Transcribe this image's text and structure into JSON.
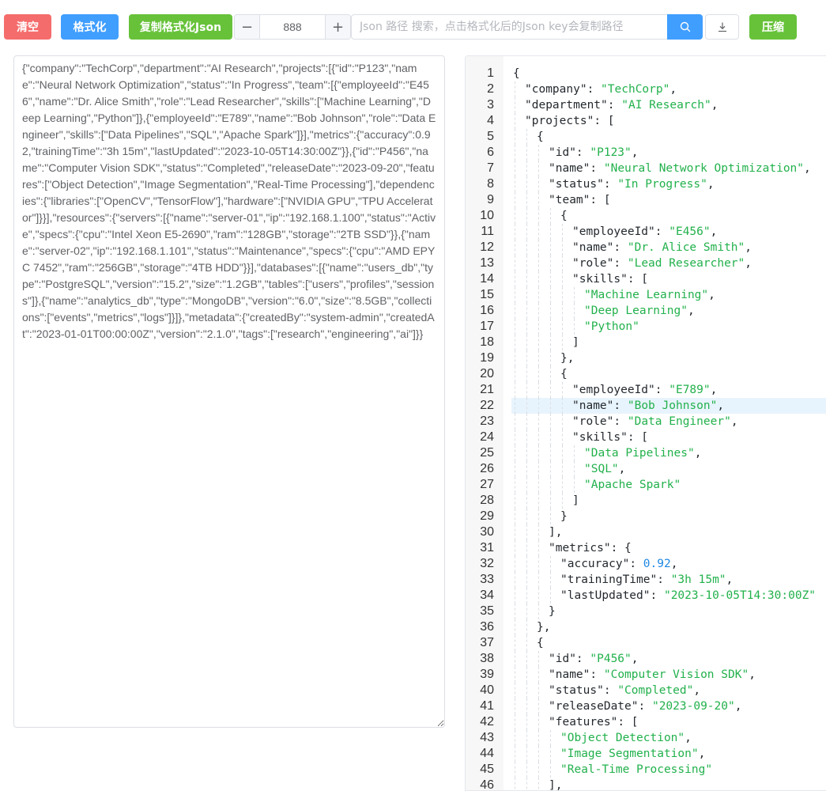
{
  "toolbar": {
    "clear_label": "清空",
    "format_label": "格式化",
    "copy_label": "复制格式化Json",
    "indent_value": "888",
    "minus": "−",
    "plus": "+",
    "search_placeholder": "Json 路径 搜索，点击格式化后的Json key会复制路径",
    "compress_label": "压缩"
  },
  "raw_json": "{\"company\":\"TechCorp\",\"department\":\"AI Research\",\"projects\":[{\"id\":\"P123\",\"name\":\"Neural Network Optimization\",\"status\":\"In Progress\",\"team\":[{\"employeeId\":\"E456\",\"name\":\"Dr. Alice Smith\",\"role\":\"Lead Researcher\",\"skills\":[\"Machine Learning\",\"Deep Learning\",\"Python\"]},{\"employeeId\":\"E789\",\"name\":\"Bob Johnson\",\"role\":\"Data Engineer\",\"skills\":[\"Data Pipelines\",\"SQL\",\"Apache Spark\"]}],\"metrics\":{\"accuracy\":0.92,\"trainingTime\":\"3h 15m\",\"lastUpdated\":\"2023-10-05T14:30:00Z\"}},{\"id\":\"P456\",\"name\":\"Computer Vision SDK\",\"status\":\"Completed\",\"releaseDate\":\"2023-09-20\",\"features\":[\"Object Detection\",\"Image Segmentation\",\"Real-Time Processing\"],\"dependencies\":{\"libraries\":[\"OpenCV\",\"TensorFlow\"],\"hardware\":[\"NVIDIA GPU\",\"TPU Accelerator\"]}}],\"resources\":{\"servers\":[{\"name\":\"server-01\",\"ip\":\"192.168.1.100\",\"status\":\"Active\",\"specs\":{\"cpu\":\"Intel Xeon E5-2690\",\"ram\":\"128GB\",\"storage\":\"2TB SSD\"}},{\"name\":\"server-02\",\"ip\":\"192.168.1.101\",\"status\":\"Maintenance\",\"specs\":{\"cpu\":\"AMD EPYC 7452\",\"ram\":\"256GB\",\"storage\":\"4TB HDD\"}}],\"databases\":[{\"name\":\"users_db\",\"type\":\"PostgreSQL\",\"version\":\"15.2\",\"size\":\"1.2GB\",\"tables\":[\"users\",\"profiles\",\"sessions\"]},{\"name\":\"analytics_db\",\"type\":\"MongoDB\",\"version\":\"6.0\",\"size\":\"8.5GB\",\"collections\":[\"events\",\"metrics\",\"logs\"]}]},\"metadata\":{\"createdBy\":\"system-admin\",\"createdAt\":\"2023-01-01T00:00:00Z\",\"version\":\"2.1.0\",\"tags\":[\"research\",\"engineering\",\"ai\"]}}",
  "highlighted_line": 22,
  "code_lines": [
    {
      "n": "1",
      "indent": 0,
      "parts": [
        [
          "p",
          "{"
        ]
      ]
    },
    {
      "n": "2",
      "indent": 1,
      "parts": [
        [
          "k",
          "\"company\""
        ],
        [
          "p",
          ": "
        ],
        [
          "s",
          "\"TechCorp\""
        ],
        [
          "p",
          ","
        ]
      ]
    },
    {
      "n": "3",
      "indent": 1,
      "parts": [
        [
          "k",
          "\"department\""
        ],
        [
          "p",
          ": "
        ],
        [
          "s",
          "\"AI Research\""
        ],
        [
          "p",
          ","
        ]
      ]
    },
    {
      "n": "4",
      "indent": 1,
      "parts": [
        [
          "k",
          "\"projects\""
        ],
        [
          "p",
          ": ["
        ]
      ]
    },
    {
      "n": "5",
      "indent": 2,
      "parts": [
        [
          "p",
          "{"
        ]
      ]
    },
    {
      "n": "6",
      "indent": 3,
      "parts": [
        [
          "k",
          "\"id\""
        ],
        [
          "p",
          ": "
        ],
        [
          "s",
          "\"P123\""
        ],
        [
          "p",
          ","
        ]
      ]
    },
    {
      "n": "7",
      "indent": 3,
      "parts": [
        [
          "k",
          "\"name\""
        ],
        [
          "p",
          ": "
        ],
        [
          "s",
          "\"Neural Network Optimization\""
        ],
        [
          "p",
          ","
        ]
      ]
    },
    {
      "n": "8",
      "indent": 3,
      "parts": [
        [
          "k",
          "\"status\""
        ],
        [
          "p",
          ": "
        ],
        [
          "s",
          "\"In Progress\""
        ],
        [
          "p",
          ","
        ]
      ]
    },
    {
      "n": "9",
      "indent": 3,
      "parts": [
        [
          "k",
          "\"team\""
        ],
        [
          "p",
          ": ["
        ]
      ]
    },
    {
      "n": "10",
      "indent": 4,
      "parts": [
        [
          "p",
          "{"
        ]
      ]
    },
    {
      "n": "11",
      "indent": 5,
      "parts": [
        [
          "k",
          "\"employeeId\""
        ],
        [
          "p",
          ": "
        ],
        [
          "s",
          "\"E456\""
        ],
        [
          "p",
          ","
        ]
      ]
    },
    {
      "n": "12",
      "indent": 5,
      "parts": [
        [
          "k",
          "\"name\""
        ],
        [
          "p",
          ": "
        ],
        [
          "s",
          "\"Dr. Alice Smith\""
        ],
        [
          "p",
          ","
        ]
      ]
    },
    {
      "n": "13",
      "indent": 5,
      "parts": [
        [
          "k",
          "\"role\""
        ],
        [
          "p",
          ": "
        ],
        [
          "s",
          "\"Lead Researcher\""
        ],
        [
          "p",
          ","
        ]
      ]
    },
    {
      "n": "14",
      "indent": 5,
      "parts": [
        [
          "k",
          "\"skills\""
        ],
        [
          "p",
          ": ["
        ]
      ]
    },
    {
      "n": "15",
      "indent": 6,
      "parts": [
        [
          "s",
          "\"Machine Learning\""
        ],
        [
          "p",
          ","
        ]
      ]
    },
    {
      "n": "16",
      "indent": 6,
      "parts": [
        [
          "s",
          "\"Deep Learning\""
        ],
        [
          "p",
          ","
        ]
      ]
    },
    {
      "n": "17",
      "indent": 6,
      "parts": [
        [
          "s",
          "\"Python\""
        ]
      ]
    },
    {
      "n": "18",
      "indent": 5,
      "parts": [
        [
          "p",
          "]"
        ]
      ]
    },
    {
      "n": "19",
      "indent": 4,
      "parts": [
        [
          "p",
          "},"
        ]
      ]
    },
    {
      "n": "20",
      "indent": 4,
      "parts": [
        [
          "p",
          "{"
        ]
      ]
    },
    {
      "n": "21",
      "indent": 5,
      "parts": [
        [
          "k",
          "\"employeeId\""
        ],
        [
          "p",
          ": "
        ],
        [
          "s",
          "\"E789\""
        ],
        [
          "p",
          ","
        ]
      ]
    },
    {
      "n": "22",
      "indent": 5,
      "parts": [
        [
          "k",
          "\"name\""
        ],
        [
          "p",
          ": "
        ],
        [
          "s",
          "\"Bob Johnson\""
        ],
        [
          "p",
          ","
        ]
      ]
    },
    {
      "n": "23",
      "indent": 5,
      "parts": [
        [
          "k",
          "\"role\""
        ],
        [
          "p",
          ": "
        ],
        [
          "s",
          "\"Data Engineer\""
        ],
        [
          "p",
          ","
        ]
      ]
    },
    {
      "n": "24",
      "indent": 5,
      "parts": [
        [
          "k",
          "\"skills\""
        ],
        [
          "p",
          ": ["
        ]
      ]
    },
    {
      "n": "25",
      "indent": 6,
      "parts": [
        [
          "s",
          "\"Data Pipelines\""
        ],
        [
          "p",
          ","
        ]
      ]
    },
    {
      "n": "26",
      "indent": 6,
      "parts": [
        [
          "s",
          "\"SQL\""
        ],
        [
          "p",
          ","
        ]
      ]
    },
    {
      "n": "27",
      "indent": 6,
      "parts": [
        [
          "s",
          "\"Apache Spark\""
        ]
      ]
    },
    {
      "n": "28",
      "indent": 5,
      "parts": [
        [
          "p",
          "]"
        ]
      ]
    },
    {
      "n": "29",
      "indent": 4,
      "parts": [
        [
          "p",
          "}"
        ]
      ]
    },
    {
      "n": "30",
      "indent": 3,
      "parts": [
        [
          "p",
          "],"
        ]
      ]
    },
    {
      "n": "31",
      "indent": 3,
      "parts": [
        [
          "k",
          "\"metrics\""
        ],
        [
          "p",
          ": {"
        ]
      ]
    },
    {
      "n": "32",
      "indent": 4,
      "parts": [
        [
          "k",
          "\"accuracy\""
        ],
        [
          "p",
          ": "
        ],
        [
          "n",
          "0.92"
        ],
        [
          "p",
          ","
        ]
      ]
    },
    {
      "n": "33",
      "indent": 4,
      "parts": [
        [
          "k",
          "\"trainingTime\""
        ],
        [
          "p",
          ": "
        ],
        [
          "s",
          "\"3h 15m\""
        ],
        [
          "p",
          ","
        ]
      ]
    },
    {
      "n": "34",
      "indent": 4,
      "parts": [
        [
          "k",
          "\"lastUpdated\""
        ],
        [
          "p",
          ": "
        ],
        [
          "s",
          "\"2023-10-05T14:30:00Z\""
        ]
      ]
    },
    {
      "n": "35",
      "indent": 3,
      "parts": [
        [
          "p",
          "}"
        ]
      ]
    },
    {
      "n": "36",
      "indent": 2,
      "parts": [
        [
          "p",
          "},"
        ]
      ]
    },
    {
      "n": "37",
      "indent": 2,
      "parts": [
        [
          "p",
          "{"
        ]
      ]
    },
    {
      "n": "38",
      "indent": 3,
      "parts": [
        [
          "k",
          "\"id\""
        ],
        [
          "p",
          ": "
        ],
        [
          "s",
          "\"P456\""
        ],
        [
          "p",
          ","
        ]
      ]
    },
    {
      "n": "39",
      "indent": 3,
      "parts": [
        [
          "k",
          "\"name\""
        ],
        [
          "p",
          ": "
        ],
        [
          "s",
          "\"Computer Vision SDK\""
        ],
        [
          "p",
          ","
        ]
      ]
    },
    {
      "n": "40",
      "indent": 3,
      "parts": [
        [
          "k",
          "\"status\""
        ],
        [
          "p",
          ": "
        ],
        [
          "s",
          "\"Completed\""
        ],
        [
          "p",
          ","
        ]
      ]
    },
    {
      "n": "41",
      "indent": 3,
      "parts": [
        [
          "k",
          "\"releaseDate\""
        ],
        [
          "p",
          ": "
        ],
        [
          "s",
          "\"2023-09-20\""
        ],
        [
          "p",
          ","
        ]
      ]
    },
    {
      "n": "42",
      "indent": 3,
      "parts": [
        [
          "k",
          "\"features\""
        ],
        [
          "p",
          ": ["
        ]
      ]
    },
    {
      "n": "43",
      "indent": 4,
      "parts": [
        [
          "s",
          "\"Object Detection\""
        ],
        [
          "p",
          ","
        ]
      ]
    },
    {
      "n": "44",
      "indent": 4,
      "parts": [
        [
          "s",
          "\"Image Segmentation\""
        ],
        [
          "p",
          ","
        ]
      ]
    },
    {
      "n": "45",
      "indent": 4,
      "parts": [
        [
          "s",
          "\"Real-Time Processing\""
        ]
      ]
    },
    {
      "n": "46",
      "indent": 3,
      "parts": [
        [
          "p",
          "],"
        ]
      ]
    }
  ]
}
